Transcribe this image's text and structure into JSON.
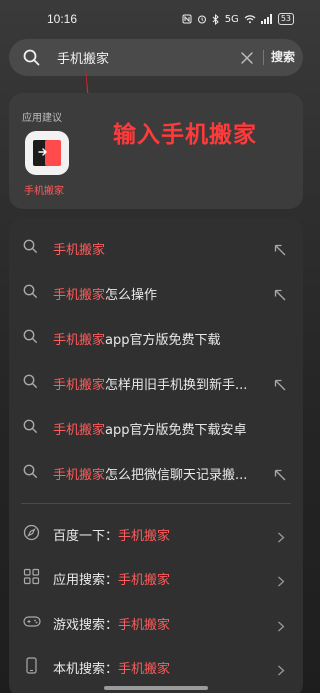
{
  "status_bar": {
    "time": "10:16",
    "network": "5G",
    "battery": "53"
  },
  "search": {
    "query": "手机搬家",
    "button_label": "搜索"
  },
  "app_suggestion": {
    "title": "应用建议",
    "app_name": "手机搬家"
  },
  "annotation": {
    "text": "输入手机搬家"
  },
  "suggestions": [
    {
      "highlight": "手机搬家",
      "rest": ""
    },
    {
      "highlight": "手机搬家",
      "rest": "怎么操作"
    },
    {
      "highlight": "手机搬家",
      "rest": "app官方版免费下载"
    },
    {
      "highlight": "手机搬家",
      "rest": "怎样用旧手机换到新手..."
    },
    {
      "highlight": "手机搬家",
      "rest": "app官方版免费下载安卓"
    },
    {
      "highlight": "手机搬家",
      "rest": "怎么把微信聊天记录搬..."
    }
  ],
  "actions": [
    {
      "label": "百度一下：",
      "query": "手机搬家",
      "icon": "compass-icon"
    },
    {
      "label": "应用搜索：",
      "query": "手机搬家",
      "icon": "grid-icon"
    },
    {
      "label": "游戏搜索：",
      "query": "手机搬家",
      "icon": "gamepad-icon"
    },
    {
      "label": "本机搜索：",
      "query": "手机搬家",
      "icon": "phone-icon"
    }
  ],
  "colors": {
    "highlight": "#ff5c5c",
    "annotation": "#ff3a3a"
  }
}
